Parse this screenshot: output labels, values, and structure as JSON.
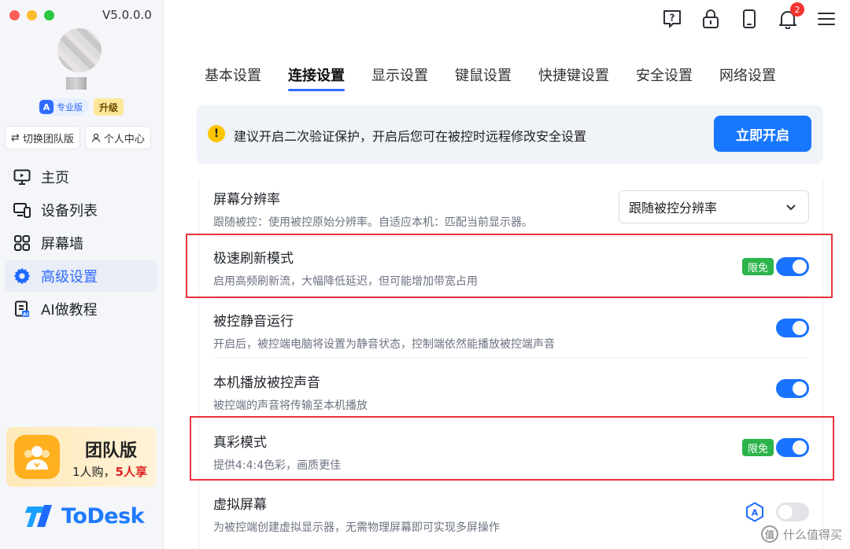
{
  "app": {
    "version": "V5.0.0.0"
  },
  "account": {
    "edition_badge": "专业版",
    "upgrade_label": "升级"
  },
  "sidebar": {
    "switch_team_label": "切换团队版",
    "personal_center_label": "个人中心",
    "items": [
      {
        "label": "主页",
        "icon": "monitor-icon"
      },
      {
        "label": "设备列表",
        "icon": "devices-icon"
      },
      {
        "label": "屏幕墙",
        "icon": "grid-icon"
      },
      {
        "label": "高级设置",
        "icon": "gear-icon",
        "active": true
      },
      {
        "label": "AI做教程",
        "icon": "doc-ai-icon"
      }
    ],
    "promo": {
      "title": "团队版",
      "sub_prefix": "1人购，",
      "sub_highlight": "5人享"
    },
    "logo_text": "ToDesk"
  },
  "header": {
    "notification_count": "2"
  },
  "tabs": [
    "基本设置",
    "连接设置",
    "显示设置",
    "键鼠设置",
    "快捷键设置",
    "安全设置",
    "网络设置"
  ],
  "active_tab": "连接设置",
  "banner": {
    "text": "建议开启二次验证保护，开启后您可在被控时远程修改安全设置",
    "button_label": "立即开启"
  },
  "settings": [
    {
      "title": "屏幕分辨率",
      "desc": "跟随被控：使用被控原始分辨率。自适应本机：匹配当前显示器。",
      "control": "select",
      "value": "跟随被控分辨率"
    },
    {
      "title": "极速刷新模式",
      "desc": "启用高频刷新流，大幅降低延迟，但可能增加带宽占用",
      "control": "toggle",
      "on": true,
      "tag": "限免",
      "highlighted": true
    },
    {
      "title": "被控静音运行",
      "desc": "开启后，被控端电脑将设置为静音状态，控制端依然能播放被控端声音",
      "control": "toggle",
      "on": true
    },
    {
      "title": "本机播放被控声音",
      "desc": "被控端的声音将传输至本机播放",
      "control": "toggle",
      "on": true
    },
    {
      "title": "真彩模式",
      "desc": "提供4:4:4色彩，画质更佳",
      "control": "toggle",
      "on": true,
      "tag": "限免",
      "highlighted": true
    },
    {
      "title": "虚拟屏幕",
      "desc": "为被控端创建虚拟显示器，无需物理屏幕即可实现多屏操作",
      "control": "toggle",
      "on": false,
      "badge_icon": "pro-a-icon"
    }
  ],
  "watermark": {
    "mark": "值",
    "text": "什么值得买"
  },
  "colors": {
    "accent": "#1a73ff",
    "highlight_border": "#e8333e",
    "tag_green": "#2bb44a"
  }
}
